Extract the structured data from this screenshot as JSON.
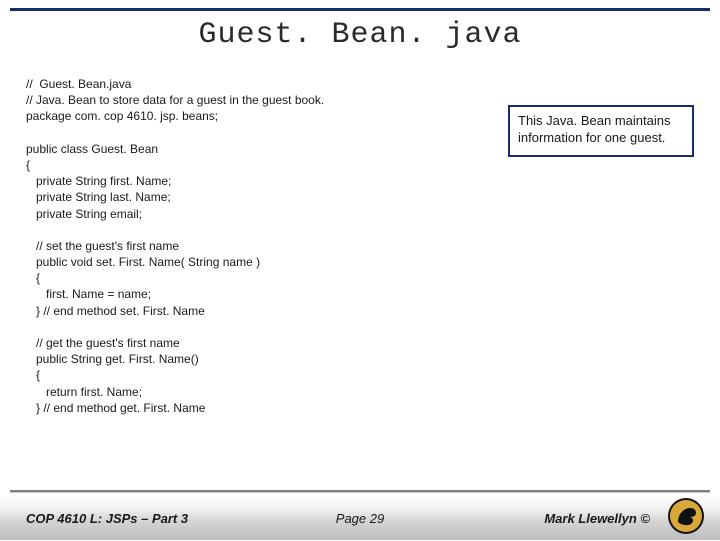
{
  "title": "Guest. Bean. java",
  "code": "//  Guest. Bean.java\n// Java. Bean to store data for a guest in the guest book.\npackage com. cop 4610. jsp. beans;\n\npublic class Guest. Bean\n{\n   private String first. Name;\n   private String last. Name;\n   private String email;\n\n   // set the guest's first name\n   public void set. First. Name( String name )\n   {\n      first. Name = name;\n   } // end method set. First. Name\n\n   // get the guest's first name\n   public String get. First. Name()\n   {\n      return first. Name;\n   } // end method get. First. Name",
  "callout": "This Java. Bean maintains information for one guest.",
  "footer": {
    "left": "COP 4610 L: JSPs – Part 3",
    "center": "Page 29",
    "right": "Mark Llewellyn ©"
  }
}
